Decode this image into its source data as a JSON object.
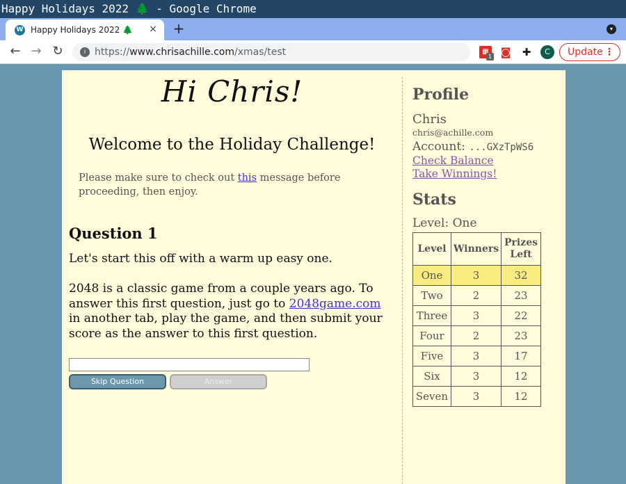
{
  "window": {
    "title": "Happy Holidays 2022 🌲 - Google Chrome"
  },
  "tab": {
    "title": "Happy Holidays 2022 🌲",
    "close": "×",
    "new_tab": "+"
  },
  "toolbar": {
    "back": "←",
    "forward": "→",
    "reload": "↻",
    "url_scheme": "https://",
    "url_host": "www.chrisachille.com",
    "url_path": "/xmas/test",
    "extension_badge": "1",
    "avatar_letter": "C",
    "update_label": "Update",
    "update_menu": "⋮"
  },
  "main": {
    "greeting": "Hi Chris!",
    "welcome": "Welcome to the Holiday Challenge!",
    "notice_before": "Please make sure to check out ",
    "notice_link": "this",
    "notice_after": " message before proceeding, then enjoy.",
    "question_title": "Question 1",
    "question_intro": "Let's start this off with a warm up easy one.",
    "question_text_before": "2048 is a classic game from a couple years ago. To answer this first question, just go to ",
    "question_link": "2048game.com",
    "question_text_after": " in another tab, play the game, and then submit your score as the answer to this first question.",
    "answer_value": "",
    "skip_label": "Skip Question",
    "answer_label": "Answer"
  },
  "profile": {
    "heading": "Profile",
    "name": "Chris",
    "email": "chris@achille.com",
    "account_label": "Account: ",
    "account_value": "...GXzTpWS6",
    "check_balance": "Check Balance",
    "take_winnings": "Take Winnings!"
  },
  "stats": {
    "heading": "Stats",
    "level_line": "Level: One",
    "columns": [
      "Level",
      "Winners",
      "Prizes Left"
    ],
    "rows": [
      {
        "level": "One",
        "winners": "3",
        "prizes": "32",
        "current": true
      },
      {
        "level": "Two",
        "winners": "2",
        "prizes": "23",
        "current": false
      },
      {
        "level": "Three",
        "winners": "3",
        "prizes": "22",
        "current": false
      },
      {
        "level": "Four",
        "winners": "2",
        "prizes": "23",
        "current": false
      },
      {
        "level": "Five",
        "winners": "3",
        "prizes": "17",
        "current": false
      },
      {
        "level": "Six",
        "winners": "3",
        "prizes": "12",
        "current": false
      },
      {
        "level": "Seven",
        "winners": "3",
        "prizes": "12",
        "current": false
      }
    ]
  },
  "colors": {
    "page_background": "#fffbdb",
    "desktop_background": "#6997ad",
    "current_level_highlight": "#f7ec7d",
    "update_accent": "#d93025",
    "link_color": "#4433cc"
  }
}
